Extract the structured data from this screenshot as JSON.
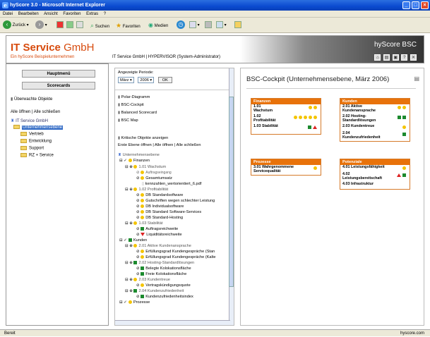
{
  "window": {
    "title": "hyScore 3.0 - Microsoft Internet Explorer"
  },
  "menu": [
    "Datei",
    "Bearbeiten",
    "Ansicht",
    "Favoriten",
    "Extras",
    "?"
  ],
  "toolbar": {
    "back": "Zurück",
    "search": "Suchen",
    "favorites": "Favoriten",
    "media": "Medien"
  },
  "header": {
    "logo_a": "IT Service",
    "logo_b": "GmbH",
    "logo_sub": "Ein hyScore Beispielunternehmen",
    "user_line": "IT Service GmbH | HYPERVISOR  (System-Administrator)",
    "brand": "hyScore BSC"
  },
  "leftnav": {
    "btn_main": "Hauptmenü",
    "btn_scorecards": "Scorecards",
    "overview": "Überwachte Objekte",
    "expand": "Alle öffnen | Alle schließen",
    "tree": [
      "IT Service GmbH",
      "Unternehmensebene",
      "Vertrieb",
      "Entwicklung",
      "Support",
      "RZ + Service"
    ]
  },
  "mid": {
    "period_label": "Angezeigte Periode:",
    "month": "März",
    "year": "2006",
    "ok": "OK",
    "links": [
      "Polar-Diagramm",
      "BSC-Cockpit",
      "Balanced Scorecard",
      "BSC Map"
    ],
    "critical": "Kritische Objekte anzeigen",
    "level_open": "Erste Ebene öffnen | Alle öffnen | Alle schließen",
    "root": "Unternehmensebene",
    "lines": [
      "Finanzen",
      "1.01 Wachstum",
      "Auftragseingang",
      "Gesamtumsatz",
      "kennzahlen_wertorientiert_6.pdf",
      "1.02 Profitabilität",
      "DB Standardsoftware",
      "Gutschriften wegen schlechter Leistung",
      "DB Individualsoftware",
      "DB Standard Software-Services",
      "DB Standard-Hosting",
      "1.03 Stabilität",
      "Auftragsreichweite",
      "Liquiditätsreichweite",
      "Kunden",
      "2.01 Aktive Kundenansprache",
      "Erfüllungsgrad Kundengespräche (Stan",
      "Erfüllungsgrad Kundengespräche (Kalte",
      "2.02 Hosting-Standardlösungen",
      "Belegte Kolokationsfläche",
      "Freie Kolokationsfläche",
      "2.03 Kundentreue",
      "Vertragskündigungsquote",
      "2.04 Kundenzufriedenheit",
      "Kundenzufriedenheitsindex",
      "Prozesse"
    ]
  },
  "cockpit": {
    "title": "BSC-Cockpit (Unternehmensebene, März 2006)",
    "cards": [
      {
        "title": "Finanzen",
        "rows": [
          "1.01 Wachstum",
          "1.02 Profitabilität",
          "1.03 Stabilität"
        ]
      },
      {
        "title": "Kunden",
        "rows": [
          "2.01 Aktive Kundenansprache",
          "2.02 Hosting-Standardlösungen",
          "2.03 Kundentreue",
          "2.04 Kundenzufriedenheit"
        ]
      },
      {
        "title": "Prozesse",
        "rows": [
          "3.01 Wahrgenommene Servicequalität"
        ]
      },
      {
        "title": "Potenziale",
        "rows": [
          "4.01 Leistungsfähigkeit",
          "4.02 Leistungsbereitschaft",
          "4.03 Infrastruktur"
        ]
      }
    ]
  },
  "status": {
    "left": "Bereit",
    "right": "hyscore.com"
  },
  "colors": {
    "accent": "#e8720a",
    "yellow": "#f4c400",
    "green": "#1c8a2e",
    "red": "#d22222"
  }
}
